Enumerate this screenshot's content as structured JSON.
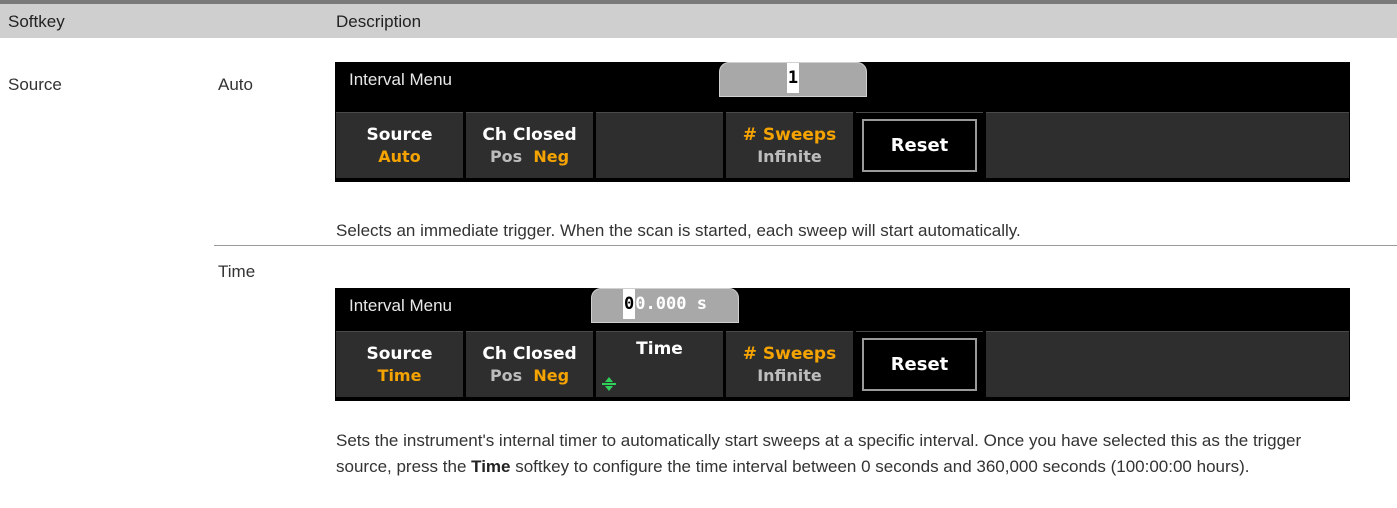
{
  "table": {
    "headers": {
      "softkey": "Softkey",
      "description": "Description"
    },
    "row": {
      "softkey": "Source",
      "options": [
        {
          "name": "Auto",
          "screen": {
            "menu_title": "Interval Menu",
            "display_value": "1",
            "keys": [
              {
                "line1": "Source",
                "line2": "Auto"
              },
              {
                "line1": "Ch Closed",
                "line2_a": "Pos",
                "line2_b": "Neg"
              },
              {
                "line1": ""
              },
              {
                "line1": "# Sweeps",
                "line2": "Infinite"
              },
              {
                "line1": "Reset"
              },
              {
                "line1": ""
              }
            ]
          },
          "description": "Selects an immediate trigger. When the scan is started, each sweep will start automatically."
        },
        {
          "name": "Time",
          "screen": {
            "menu_title": "Interval Menu",
            "display_cursor": "0",
            "display_rest": "0.000 s",
            "keys": [
              {
                "line1": "Source",
                "line2": "Time"
              },
              {
                "line1": "Ch Closed",
                "line2_a": "Pos",
                "line2_b": "Neg"
              },
              {
                "line1": "Time",
                "icon": "up-down-arrow-icon"
              },
              {
                "line1": "# Sweeps",
                "line2": "Infinite"
              },
              {
                "line1": "Reset"
              },
              {
                "line1": ""
              }
            ]
          },
          "description_part1": "Sets the instrument's internal timer to automatically start sweeps at a specific interval. Once you have selected this as the trigger source, press the ",
          "description_bold": "Time",
          "description_part2": " softkey to configure the time interval between 0 seconds and 360,000 seconds (100:00:00 hours)."
        }
      ]
    }
  },
  "colors": {
    "accent_yellow": "#f5a300",
    "panel_bg": "#000000",
    "header_bg": "#cfcfcf"
  }
}
